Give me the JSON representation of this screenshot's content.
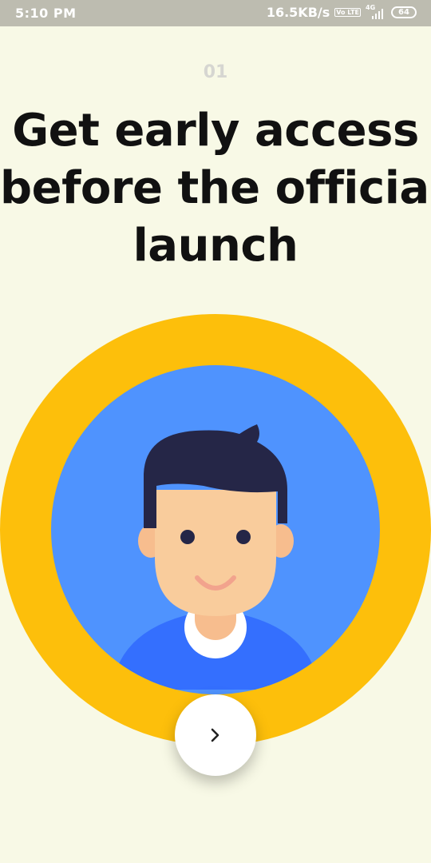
{
  "status_bar": {
    "time": "5:10 PM",
    "network_speed": "16.5KB/s",
    "volte_label": "Vo LTE",
    "network_type": "4G",
    "battery": "64",
    "icons": [
      "volte-icon",
      "signal-icon",
      "battery-icon"
    ]
  },
  "onboarding": {
    "step": "01",
    "headline_lines": [
      "Get early access",
      "before the official",
      "launch"
    ],
    "illustration": "avatar-illustration",
    "next_icon": "chevron-right-icon"
  },
  "colors": {
    "background": "#f8f9e6",
    "status_bar": "#bdbcb0",
    "ring": "#fdbf0b",
    "avatar_bg": "#4f93fe",
    "hair": "#252647",
    "skin": "#f9cc9c",
    "shirt": "#346ffe",
    "mouth": "#f2a38d"
  }
}
